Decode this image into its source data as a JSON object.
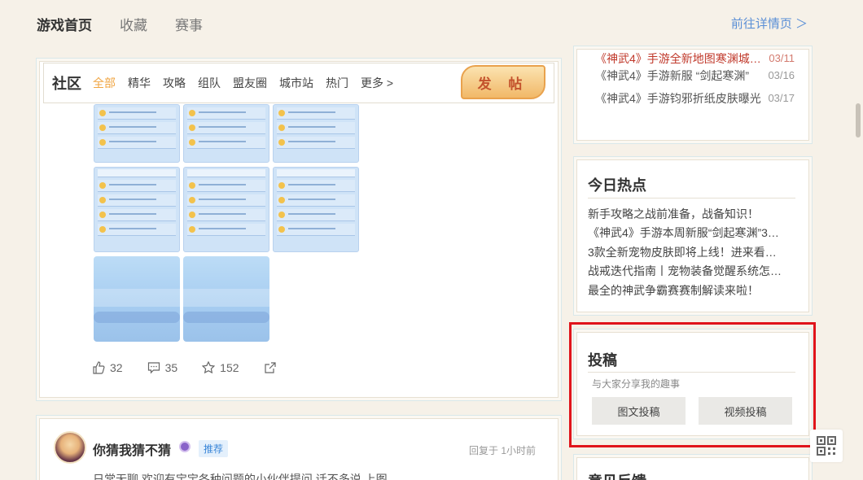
{
  "topnav": {
    "items": [
      "游戏首页",
      "收藏",
      "赛事"
    ],
    "detail_link": "前往详情页 ＞"
  },
  "community": {
    "title": "社区",
    "tabs": [
      "全部",
      "精华",
      "攻略",
      "组队",
      "盟友圈",
      "城市站",
      "热门",
      "更多 >"
    ],
    "post_button": "发 帖"
  },
  "post": {
    "likes": "32",
    "comments": "35",
    "favorites": "152"
  },
  "comment": {
    "author": "你猜我猜不猜",
    "badge": "推荐",
    "time": "回复于  1小时前",
    "text": "日常无聊 欢迎有宝宝各种问题的小伙伴提问     话不多说 上图"
  },
  "news": [
    {
      "title": "《神武4》手游全新地图寒渊城…",
      "date": "03/11"
    },
    {
      "title": "《神武4》手游新服 “剑起寒渊”",
      "date": "03/16"
    },
    {
      "title": "《神武4》手游钧邪折纸皮肤曝光",
      "date": "03/17"
    }
  ],
  "hot": {
    "title": "今日热点",
    "items": [
      "新手攻略之战前准备，战备知识！",
      "《神武4》手游本周新服“剑起寒渊”3…",
      "3款全新宠物皮肤即将上线！进来看…",
      "战戒迭代指南丨宠物装备觉醒系统怎…",
      "最全的神武争霸赛赛制解读来啦！"
    ]
  },
  "contribute": {
    "title": "投稿",
    "subtitle": "与大家分享我的趣事",
    "btn_image": "图文投稿",
    "btn_video": "视频投稿"
  },
  "feedback": {
    "title": "意见反馈"
  },
  "icons": [
    "like-icon",
    "comment-icon",
    "star-icon",
    "share-icon",
    "qr-code-icon"
  ]
}
